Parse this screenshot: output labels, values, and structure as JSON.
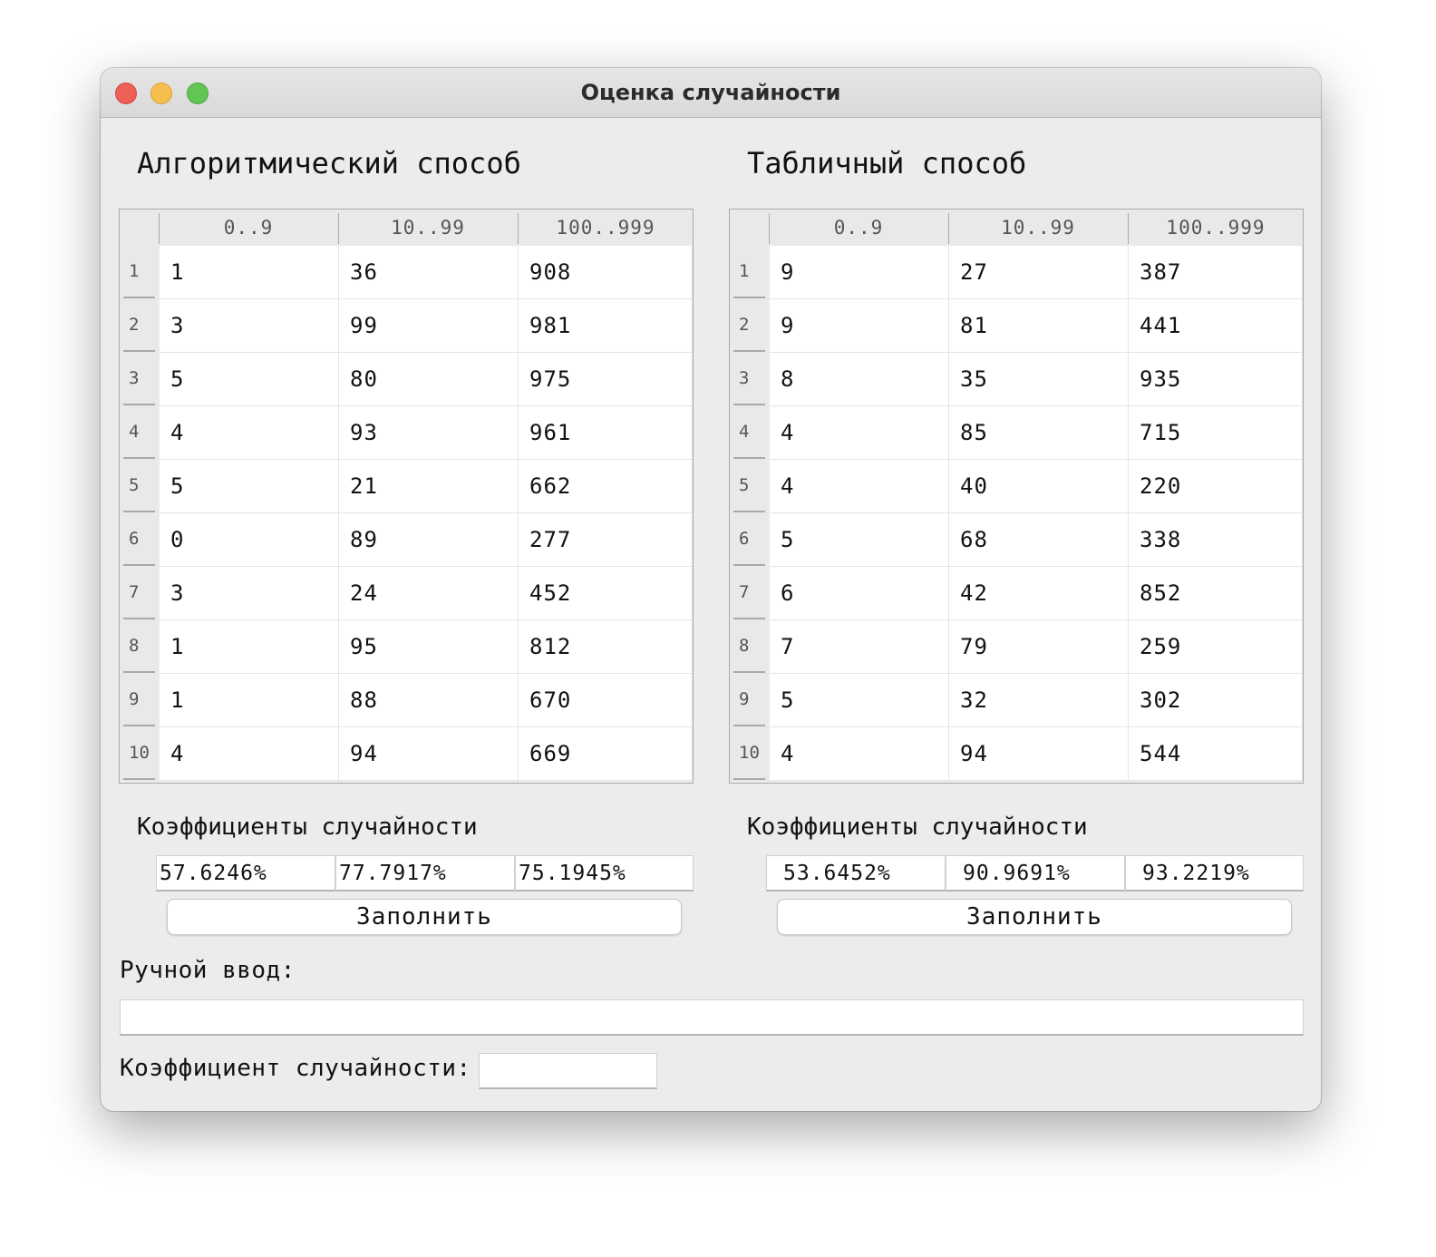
{
  "window": {
    "title": "Оценка случайности"
  },
  "algorithmic": {
    "title": "Алгоритмический способ",
    "columns": [
      "0..9",
      "10..99",
      "100..999"
    ],
    "rows": [
      {
        "n": "1",
        "v": [
          "1",
          "36",
          "908"
        ]
      },
      {
        "n": "2",
        "v": [
          "3",
          "99",
          "981"
        ]
      },
      {
        "n": "3",
        "v": [
          "5",
          "80",
          "975"
        ]
      },
      {
        "n": "4",
        "v": [
          "4",
          "93",
          "961"
        ]
      },
      {
        "n": "5",
        "v": [
          "5",
          "21",
          "662"
        ]
      },
      {
        "n": "6",
        "v": [
          "0",
          "89",
          "277"
        ]
      },
      {
        "n": "7",
        "v": [
          "3",
          "24",
          "452"
        ]
      },
      {
        "n": "8",
        "v": [
          "1",
          "95",
          "812"
        ]
      },
      {
        "n": "9",
        "v": [
          "1",
          "88",
          "670"
        ]
      },
      {
        "n": "10",
        "v": [
          "4",
          "94",
          "669"
        ]
      }
    ],
    "coef_title": "Коэффициенты случайности",
    "coefs": [
      "57.6246%",
      "77.7917%",
      "75.1945%"
    ],
    "fill_label": "Заполнить"
  },
  "tabular": {
    "title": "Табличный способ",
    "columns": [
      "0..9",
      "10..99",
      "100..999"
    ],
    "rows": [
      {
        "n": "1",
        "v": [
          "9",
          "27",
          "387"
        ]
      },
      {
        "n": "2",
        "v": [
          "9",
          "81",
          "441"
        ]
      },
      {
        "n": "3",
        "v": [
          "8",
          "35",
          "935"
        ]
      },
      {
        "n": "4",
        "v": [
          "4",
          "85",
          "715"
        ]
      },
      {
        "n": "5",
        "v": [
          "4",
          "40",
          "220"
        ]
      },
      {
        "n": "6",
        "v": [
          "5",
          "68",
          "338"
        ]
      },
      {
        "n": "7",
        "v": [
          "6",
          "42",
          "852"
        ]
      },
      {
        "n": "8",
        "v": [
          "7",
          "79",
          "259"
        ]
      },
      {
        "n": "9",
        "v": [
          "5",
          "32",
          "302"
        ]
      },
      {
        "n": "10",
        "v": [
          "4",
          "94",
          "544"
        ]
      }
    ],
    "coef_title": "Коэффициенты случайности",
    "coefs": [
      "53.6452%",
      "90.9691%",
      "93.2219%"
    ],
    "fill_label": "Заполнить"
  },
  "manual": {
    "label": "Ручной ввод:",
    "value": "",
    "coef_label": "Коэффициент случайности:",
    "coef_value": ""
  }
}
